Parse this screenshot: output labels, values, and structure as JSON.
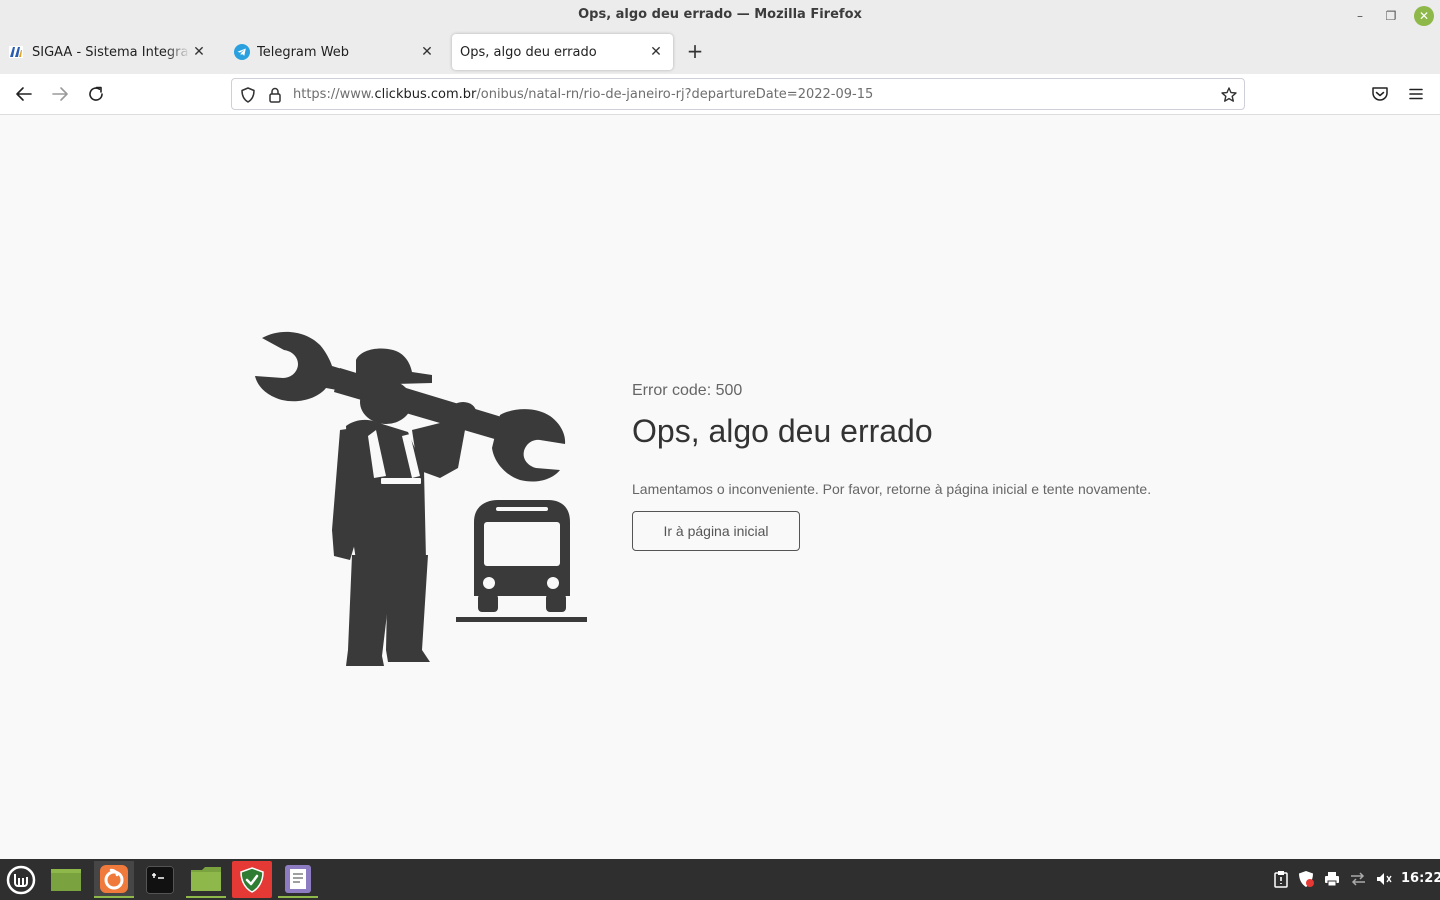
{
  "window": {
    "title": "Ops, algo deu errado — Mozilla Firefox",
    "minimize_glyph": "–",
    "maximize_glyph": "❐",
    "close_glyph": "✕"
  },
  "tabs": [
    {
      "label": "SIGAA - Sistema Integrado de Gestão",
      "icon": "sigaa-favicon",
      "active": false
    },
    {
      "label": "Telegram Web",
      "icon": "telegram-icon",
      "active": false
    },
    {
      "label": "Ops, algo deu errado",
      "icon": "",
      "active": true
    }
  ],
  "tab_close_glyph": "✕",
  "new_tab_glyph": "+",
  "url": {
    "scheme": "https://www.",
    "host": "clickbus.com.br",
    "path": "/onibus/natal-rn/rio-de-janeiro-rj?departureDate=2022-09-15"
  },
  "error_page": {
    "code_text": "Error code: 500",
    "title": "Ops, algo deu errado",
    "message": "Lamentamos o inconveniente. Por favor, retorne à página inicial e tente novamente.",
    "home_button": "Ir à página inicial"
  },
  "taskbar": {
    "apps": [
      "mint-menu-icon",
      "show-desktop-icon",
      "firefox-icon",
      "terminal-icon",
      "files-icon",
      "shield-app-icon",
      "text-editor-icon"
    ],
    "tray": [
      "clipboard-icon",
      "update-shield-icon",
      "printer-icon",
      "network-icon",
      "volume-icon"
    ],
    "clock": "16:22"
  },
  "colors": {
    "accent": "#8fb84a",
    "illustration": "#3a3a3a",
    "page_bg": "#f9f9f9",
    "taskbar_bg": "#2f2f2f"
  }
}
